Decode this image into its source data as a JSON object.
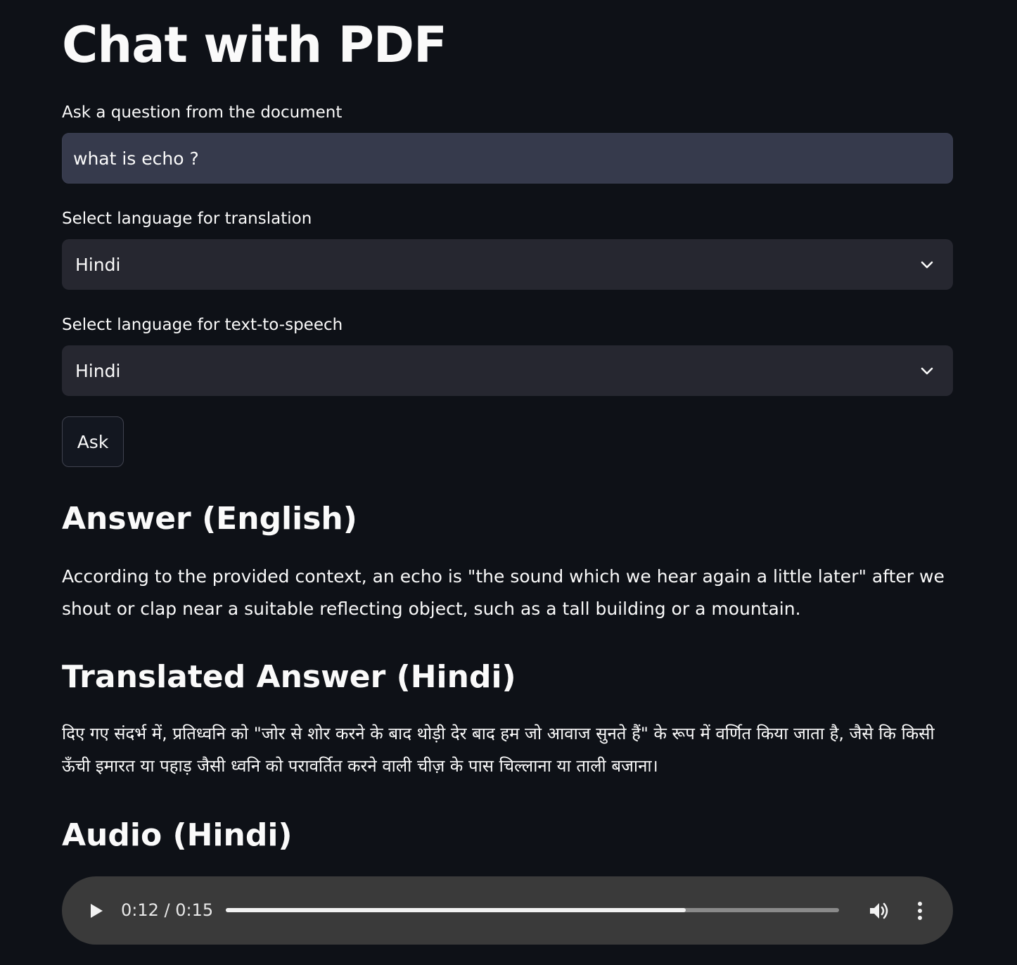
{
  "page": {
    "title": "Chat with PDF"
  },
  "question": {
    "label": "Ask a question from the document",
    "value": "what is echo ?"
  },
  "translation_select": {
    "label": "Select language for translation",
    "value": "Hindi"
  },
  "tts_select": {
    "label": "Select language for text-to-speech",
    "value": "Hindi"
  },
  "ask_button": {
    "label": "Ask"
  },
  "answer_english": {
    "heading": "Answer (English)",
    "text": "According to the provided context, an echo is \"the sound which we hear again a little later\" after we shout or clap near a suitable reflecting object, such as a tall building or a mountain."
  },
  "answer_translated": {
    "heading": "Translated Answer (Hindi)",
    "text": "दिए गए संदर्भ में, प्रतिध्वनि को \"जोर से शोर करने के बाद थोड़ी देर बाद हम जो आवाज सुनते हैं\" के रूप में वर्णित किया जाता है, जैसे कि किसी ऊँची इमारत या पहाड़ जैसी ध्वनि को परावर्तित करने वाली चीज़ के पास चिल्लाना या ताली बजाना।"
  },
  "audio": {
    "heading": "Audio (Hindi)",
    "time": "0:12 / 0:15",
    "progress": 0.75,
    "icons": {
      "play": "play-icon",
      "volume": "volume-icon",
      "menu": "more-vertical-icon"
    }
  },
  "colors": {
    "background": "#0e1117",
    "text": "#fafafa",
    "input_background": "#363a4c",
    "select_background": "#262730",
    "audio_background": "#3a3a3a"
  }
}
